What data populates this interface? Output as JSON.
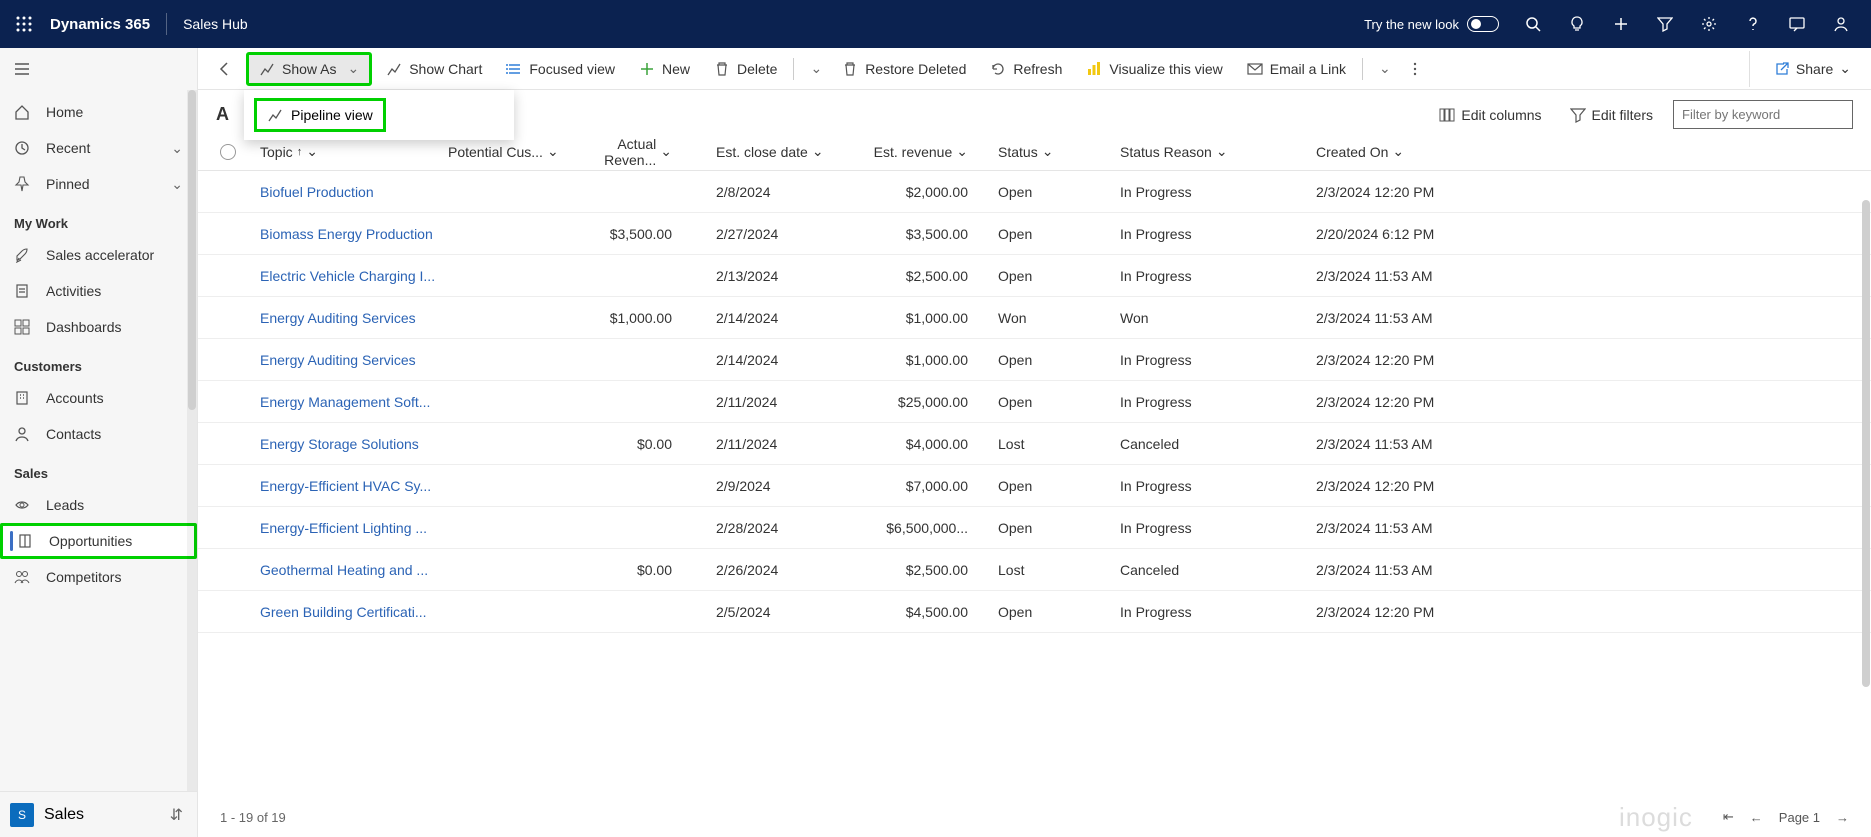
{
  "top": {
    "brand": "Dynamics 365",
    "app": "Sales Hub",
    "newlook": "Try the new look"
  },
  "sidebar": {
    "home": "Home",
    "recent": "Recent",
    "pinned": "Pinned",
    "sec_mywork": "My Work",
    "sales_accel": "Sales accelerator",
    "activities": "Activities",
    "dashboards": "Dashboards",
    "sec_customers": "Customers",
    "accounts": "Accounts",
    "contacts": "Contacts",
    "sec_sales": "Sales",
    "leads": "Leads",
    "opportunities": "Opportunities",
    "competitors": "Competitors",
    "area_badge": "S",
    "area_label": "Sales"
  },
  "cmdbar": {
    "show_as": "Show As",
    "show_chart": "Show Chart",
    "focused": "Focused view",
    "new": "New",
    "delete": "Delete",
    "restore": "Restore Deleted",
    "refresh": "Refresh",
    "visualize": "Visualize this view",
    "email": "Email a Link",
    "share": "Share"
  },
  "dropdown": {
    "pipeline": "Pipeline view"
  },
  "viewhdr": {
    "title_partial": "A",
    "edit_columns": "Edit columns",
    "edit_filters": "Edit filters",
    "filter_placeholder": "Filter by keyword"
  },
  "columns": {
    "topic": "Topic",
    "cust": "Potential Cus...",
    "actrev": "Actual Reven...",
    "close": "Est. close date",
    "estrev": "Est. revenue",
    "status": "Status",
    "reason": "Status Reason",
    "created": "Created On"
  },
  "rows": [
    {
      "topic": "Biofuel Production",
      "actrev": "",
      "close": "2/8/2024",
      "estrev": "$2,000.00",
      "status": "Open",
      "reason": "In Progress",
      "created": "2/3/2024 12:20 PM"
    },
    {
      "topic": "Biomass Energy Production",
      "actrev": "$3,500.00",
      "close": "2/27/2024",
      "estrev": "$3,500.00",
      "status": "Open",
      "reason": "In Progress",
      "created": "2/20/2024 6:12 PM"
    },
    {
      "topic": "Electric Vehicle Charging I...",
      "actrev": "",
      "close": "2/13/2024",
      "estrev": "$2,500.00",
      "status": "Open",
      "reason": "In Progress",
      "created": "2/3/2024 11:53 AM"
    },
    {
      "topic": "Energy Auditing Services",
      "actrev": "$1,000.00",
      "close": "2/14/2024",
      "estrev": "$1,000.00",
      "status": "Won",
      "reason": "Won",
      "created": "2/3/2024 11:53 AM"
    },
    {
      "topic": "Energy Auditing Services",
      "actrev": "",
      "close": "2/14/2024",
      "estrev": "$1,000.00",
      "status": "Open",
      "reason": "In Progress",
      "created": "2/3/2024 12:20 PM"
    },
    {
      "topic": "Energy Management Soft...",
      "actrev": "",
      "close": "2/11/2024",
      "estrev": "$25,000.00",
      "status": "Open",
      "reason": "In Progress",
      "created": "2/3/2024 12:20 PM"
    },
    {
      "topic": "Energy Storage Solutions",
      "actrev": "$0.00",
      "close": "2/11/2024",
      "estrev": "$4,000.00",
      "status": "Lost",
      "reason": "Canceled",
      "created": "2/3/2024 11:53 AM"
    },
    {
      "topic": "Energy-Efficient HVAC Sy...",
      "actrev": "",
      "close": "2/9/2024",
      "estrev": "$7,000.00",
      "status": "Open",
      "reason": "In Progress",
      "created": "2/3/2024 12:20 PM"
    },
    {
      "topic": "Energy-Efficient Lighting ...",
      "actrev": "",
      "close": "2/28/2024",
      "estrev": "$6,500,000...",
      "status": "Open",
      "reason": "In Progress",
      "created": "2/3/2024 11:53 AM"
    },
    {
      "topic": "Geothermal Heating and ...",
      "actrev": "$0.00",
      "close": "2/26/2024",
      "estrev": "$2,500.00",
      "status": "Lost",
      "reason": "Canceled",
      "created": "2/3/2024 11:53 AM"
    },
    {
      "topic": "Green Building Certificati...",
      "actrev": "",
      "close": "2/5/2024",
      "estrev": "$4,500.00",
      "status": "Open",
      "reason": "In Progress",
      "created": "2/3/2024 12:20 PM"
    }
  ],
  "footer": {
    "count": "1 - 19 of 19",
    "logo": "inogic",
    "page": "Page 1"
  }
}
